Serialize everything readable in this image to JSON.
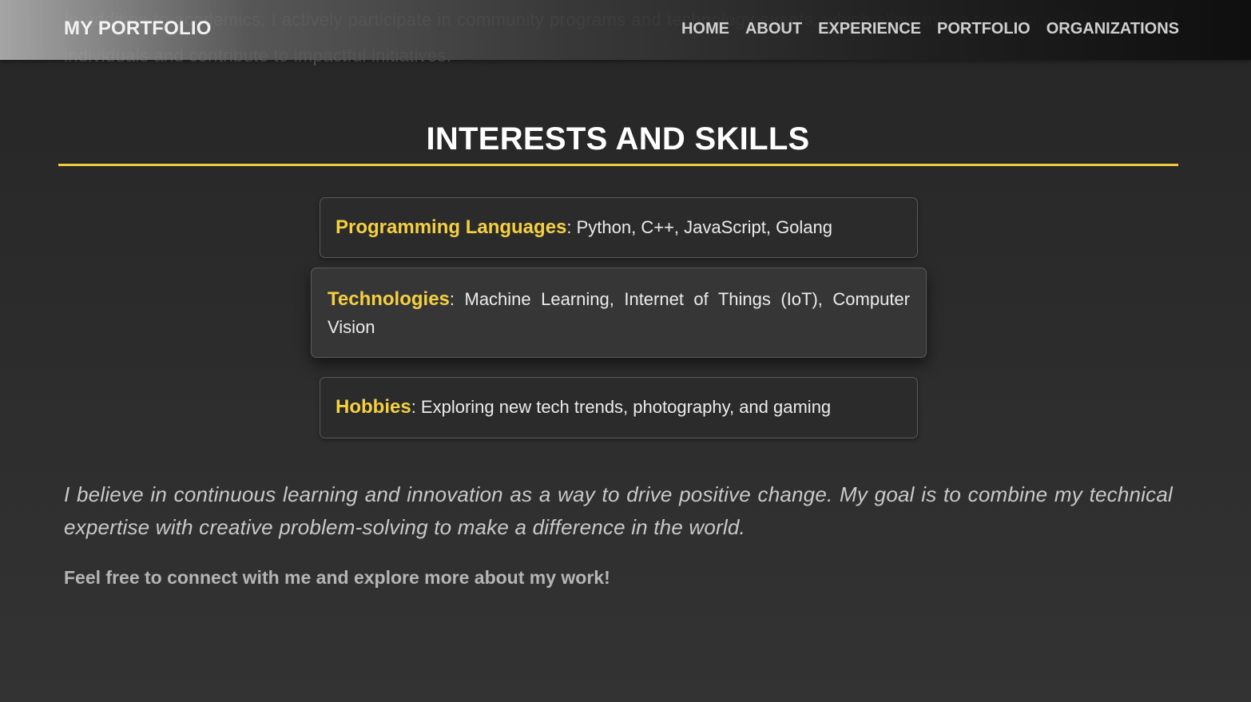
{
  "previous_section": {
    "text": "In addition to academics, I actively participate in community programs and technology events, which allow me to connect with like-minded individuals and contribute to impactful initiatives."
  },
  "navbar": {
    "brand": "MY PORTFOLIO",
    "links": [
      "HOME",
      "ABOUT",
      "EXPERIENCE",
      "PORTFOLIO",
      "ORGANIZATIONS"
    ]
  },
  "section": {
    "title": "INTERESTS AND SKILLS",
    "items": [
      {
        "key": "Programming Languages",
        "value": ": Python, C++, JavaScript, Golang"
      },
      {
        "key": "Technologies",
        "value": ": Machine Learning, Internet of Things (IoT), Computer Vision"
      },
      {
        "key": "Hobbies",
        "value": ": Exploring new tech trends, photography, and gaming"
      }
    ],
    "quote": "I believe in continuous learning and innovation as a way to drive positive change. My goal is to combine my technical expertise with creative problem-solving to make a difference in the world.",
    "cta": "Feel free to connect with me and explore more about my work!"
  },
  "colors": {
    "accent": "#f0cc3c",
    "background": "#2b2b2b"
  }
}
